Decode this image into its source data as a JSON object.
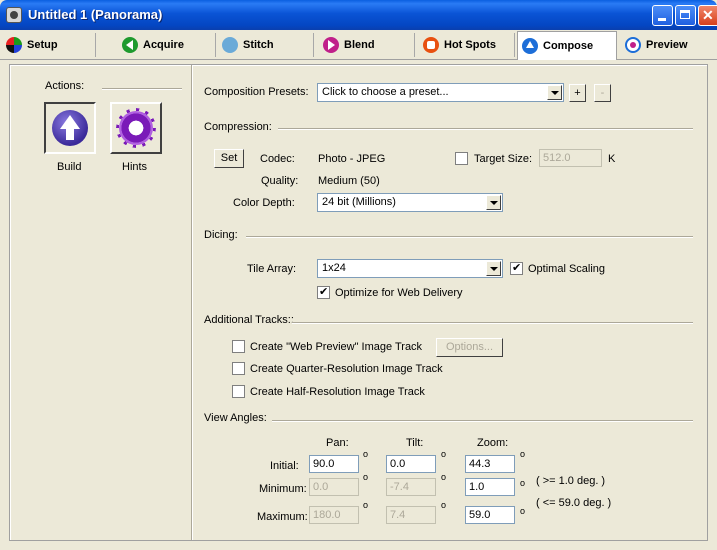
{
  "window": {
    "title": "Untitled 1 (Panorama)"
  },
  "tabs": [
    {
      "label": "Setup",
      "icon": "setup-icon"
    },
    {
      "label": "Acquire",
      "icon": "acquire-icon"
    },
    {
      "label": "Stitch",
      "icon": "stitch-icon"
    },
    {
      "label": "Blend",
      "icon": "blend-icon"
    },
    {
      "label": "Hot Spots",
      "icon": "hotspots-icon"
    },
    {
      "label": "Compose",
      "icon": "compose-icon",
      "active": true
    },
    {
      "label": "Preview",
      "icon": "preview-icon"
    }
  ],
  "actions": {
    "header": "Actions:",
    "build_label": "Build",
    "hints_label": "Hints"
  },
  "presets": {
    "label": "Composition Presets:",
    "value": "Click to choose a preset...",
    "add": "+",
    "remove": "-"
  },
  "compression": {
    "section": "Compression:",
    "set_button": "Set",
    "codec_label": "Codec:",
    "codec_value": "Photo - JPEG",
    "target_size_label": "Target Size:",
    "target_size_value": "512.0",
    "target_size_unit": "K",
    "quality_label": "Quality:",
    "quality_value": "Medium (50)",
    "color_depth_label": "Color Depth:",
    "color_depth_value": "24 bit (Millions)"
  },
  "dicing": {
    "section": "Dicing:",
    "tile_array_label": "Tile Array:",
    "tile_array_value": "1x24",
    "optimal_scaling_label": "Optimal Scaling",
    "optimal_scaling_checked": true,
    "optimize_web_label": "Optimize for Web Delivery",
    "optimize_web_checked": true
  },
  "tracks": {
    "section": "Additional Tracks::",
    "web_preview_label": "Create \"Web Preview\" Image Track",
    "options_button": "Options...",
    "quarter_label": "Create Quarter-Resolution Image Track",
    "half_label": "Create Half-Resolution Image Track"
  },
  "view_angles": {
    "section": "View Angles:",
    "pan_header": "Pan:",
    "tilt_header": "Tilt:",
    "zoom_header": "Zoom:",
    "degree_symbol": "o",
    "initial_label": "Initial:",
    "initial_pan": "90.0",
    "initial_tilt": "0.0",
    "initial_zoom": "44.3",
    "minimum_label": "Minimum:",
    "minimum_pan": "0.0",
    "minimum_tilt": "-7.4",
    "minimum_zoom": "1.0",
    "minimum_hint": "( >= 1.0 deg. )",
    "maximum_label": "Maximum:",
    "maximum_pan": "180.0",
    "maximum_tilt": "7.4",
    "maximum_zoom": "59.0",
    "maximum_hint": "( <= 59.0 deg. )"
  }
}
